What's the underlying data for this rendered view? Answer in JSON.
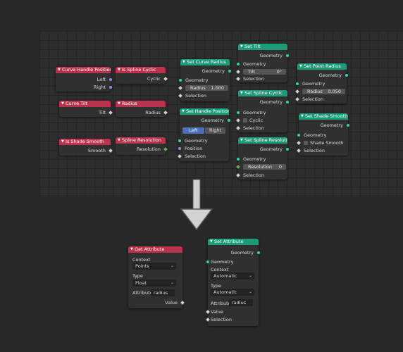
{
  "nodes": {
    "curve_handle_positions": {
      "title": "Curve Handle Positions",
      "out1": "Left",
      "out2": "Right"
    },
    "is_spline_cyclic": {
      "title": "Is Spline Cyclic",
      "out": "Cyclic"
    },
    "curve_tilt": {
      "title": "Curve Tilt",
      "out": "Tilt"
    },
    "radius": {
      "title": "Radius",
      "out": "Radius"
    },
    "is_shade_smooth": {
      "title": "Is Shade Smooth",
      "out": "Smooth"
    },
    "spline_resolution": {
      "title": "Spline Resolution",
      "out": "Resolution"
    },
    "set_curve_radius": {
      "title": "Set Curve Radius",
      "out": "Geometry",
      "geo": "Geometry",
      "radius_label": "Radius",
      "radius_value": "1.000",
      "selection": "Selection"
    },
    "set_handle_positions": {
      "title": "Set Handle Positions",
      "out": "Geometry",
      "left": "Left",
      "right": "Right",
      "geo": "Geometry",
      "position": "Position",
      "selection": "Selection"
    },
    "set_tilt": {
      "title": "Set Tilt",
      "out": "Geometry",
      "geo": "Geometry",
      "tilt_label": "Tilt",
      "tilt_value": "0°",
      "selection": "Selection"
    },
    "set_spline_cyclic": {
      "title": "Set Spline Cyclic",
      "out": "Geometry",
      "geo": "Geometry",
      "cyclic": "Cyclic",
      "selection": "Selection"
    },
    "set_spline_resolution": {
      "title": "Set Spline Resolution",
      "out": "Geometry",
      "geo": "Geometry",
      "res_label": "Resolution",
      "res_value": "0",
      "selection": "Selection"
    },
    "set_point_radius": {
      "title": "Set Point Radius",
      "out": "Geometry",
      "geo": "Geometry",
      "radius_label": "Radius",
      "radius_value": "0.050",
      "selection": "Selection"
    },
    "set_shade_smooth": {
      "title": "Set Shade Smooth",
      "out": "Geometry",
      "geo": "Geometry",
      "shade": "Shade Smooth",
      "selection": "Selection"
    },
    "get_attribute": {
      "title": "Get Attribute",
      "context_label": "Context",
      "context_value": "Points",
      "type_label": "Type",
      "type_value": "Float",
      "attr_label": "Attribute",
      "attr_value": "radius",
      "out": "Value"
    },
    "set_attribute": {
      "title": "Set Attribute",
      "out": "Geometry",
      "geo": "Geometry",
      "context_label": "Context",
      "context_value": "Automatic",
      "type_label": "Type",
      "type_value": "Automatic",
      "attr_label": "Attribute",
      "attr_value": "radius",
      "value": "Value",
      "selection": "Selection"
    }
  },
  "colors": {
    "header_red": "#b8334b",
    "header_green": "#1d9a78",
    "socket_geometry": "#2dd3a4",
    "socket_vector": "#8a8ad6",
    "socket_float": "#a1a1a1",
    "background": "#282828"
  },
  "icons": {
    "arrow": "down-arrow-icon",
    "collapse": "triangle-down-icon"
  }
}
